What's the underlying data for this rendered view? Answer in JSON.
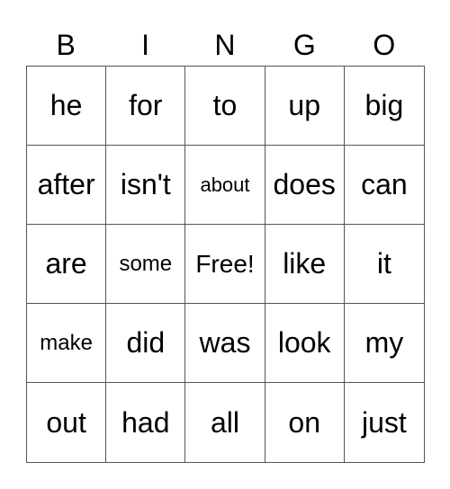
{
  "header": [
    "B",
    "I",
    "N",
    "G",
    "O"
  ],
  "cells": [
    [
      "he",
      "for",
      "to",
      "up",
      "big"
    ],
    [
      "after",
      "isn't",
      "about",
      "does",
      "can"
    ],
    [
      "are",
      "some",
      "Free!",
      "like",
      "it"
    ],
    [
      "make",
      "did",
      "was",
      "look",
      "my"
    ],
    [
      "out",
      "had",
      "all",
      "on",
      "just"
    ]
  ]
}
